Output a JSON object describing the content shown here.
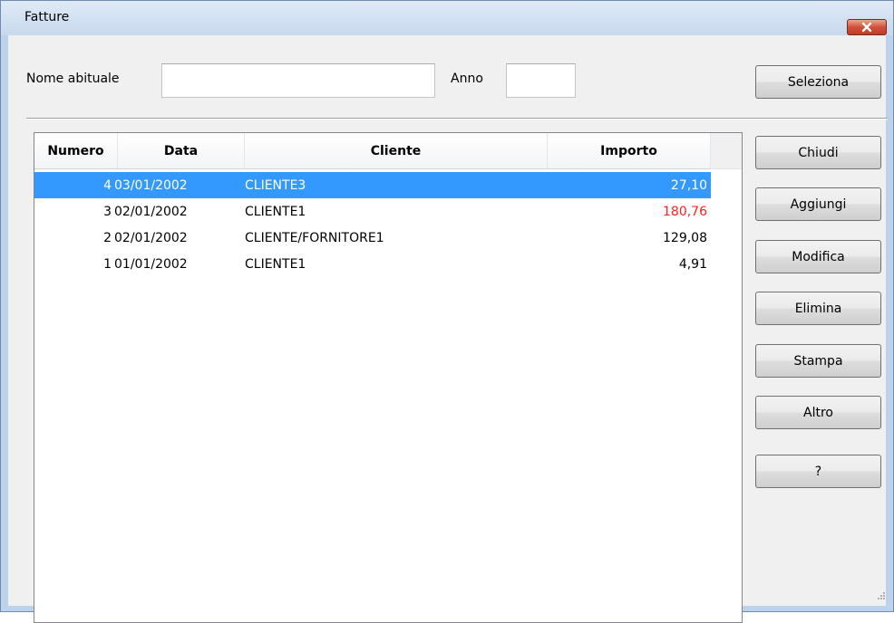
{
  "window": {
    "title": "Fatture",
    "close_icon": "close-icon"
  },
  "filters": {
    "name_label": "Nome abituale",
    "name_value": "",
    "year_label": "Anno",
    "year_value": ""
  },
  "buttons": {
    "seleziona": "Seleziona",
    "chiudi": "Chiudi",
    "aggiungi": "Aggiungi",
    "modifica": "Modifica",
    "elimina": "Elimina",
    "stampa": "Stampa",
    "altro": "Altro",
    "help": "?"
  },
  "table": {
    "columns": [
      "Numero",
      "Data",
      "Cliente",
      "Importo"
    ],
    "selected_row": 0,
    "rows": [
      {
        "numero": "4",
        "data": "03/01/2002",
        "cliente": "CLIENTE3",
        "importo": "27,10",
        "highlight": false
      },
      {
        "numero": "3",
        "data": "02/01/2002",
        "cliente": "CLIENTE1",
        "importo": "180,76",
        "highlight": true
      },
      {
        "numero": "2",
        "data": "02/01/2002",
        "cliente": "CLIENTE/FORNITORE1",
        "importo": "129,08",
        "highlight": false
      },
      {
        "numero": "1",
        "data": "01/01/2002",
        "cliente": "CLIENTE1",
        "importo": "4,91",
        "highlight": false
      }
    ]
  },
  "colors": {
    "selection": "#3399ff",
    "negative_amount": "#ff2020",
    "close_button": "#c13a22"
  }
}
